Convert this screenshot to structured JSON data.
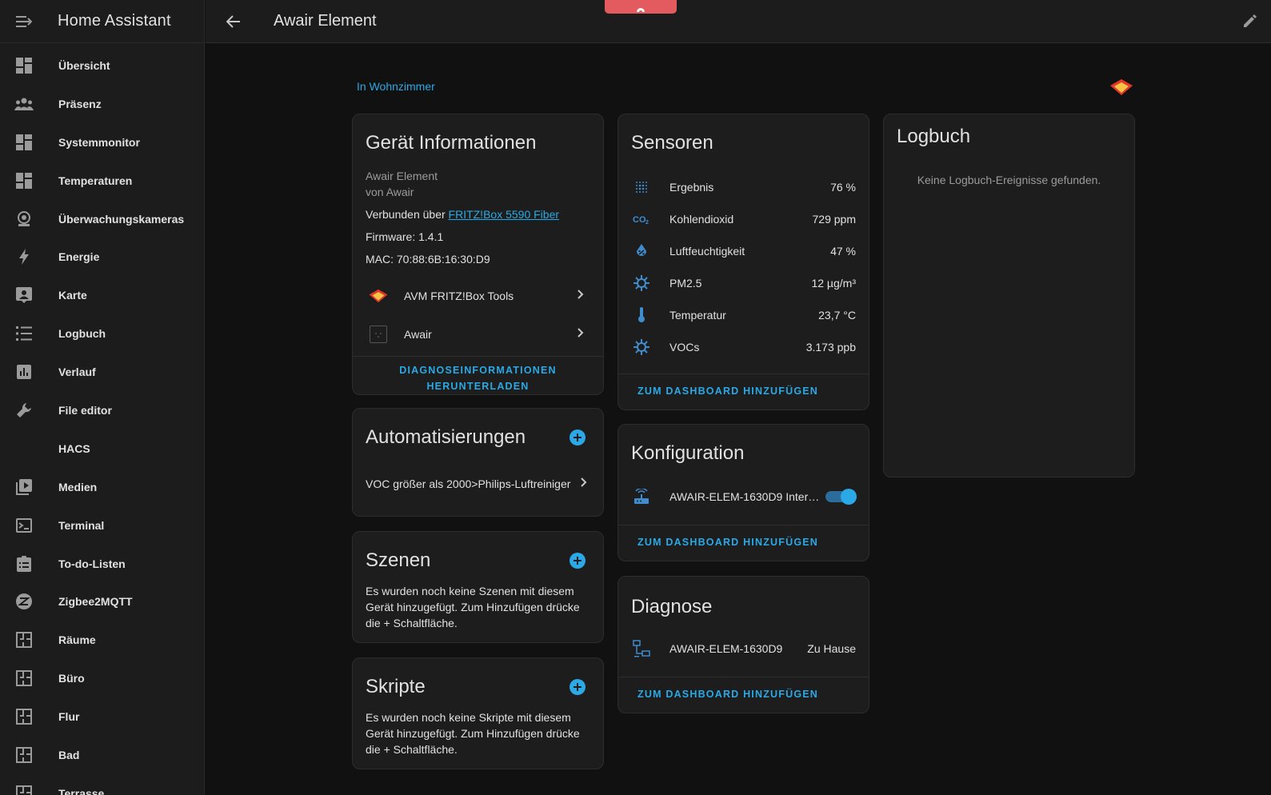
{
  "app": {
    "title": "Home Assistant"
  },
  "page": {
    "title": "Awair Element",
    "area": "In Wohnzimmer"
  },
  "colors": {
    "accent": "#2aa9e6",
    "alert": "#e35b5f",
    "sidebar_bg": "#1c1c1c",
    "card_bg": "#1d1d1d"
  },
  "sidebar": {
    "items": [
      {
        "label": "Übersicht",
        "icon": "dashboard-icon"
      },
      {
        "label": "Präsenz",
        "icon": "people-icon"
      },
      {
        "label": "Systemmonitor",
        "icon": "dashboard-icon"
      },
      {
        "label": "Temperaturen",
        "icon": "dashboard-icon"
      },
      {
        "label": "Überwachungskameras",
        "icon": "webcam-icon"
      },
      {
        "label": "Energie",
        "icon": "lightning-icon"
      },
      {
        "label": "Karte",
        "icon": "account-box-icon"
      },
      {
        "label": "Logbuch",
        "icon": "list-icon"
      },
      {
        "label": "Verlauf",
        "icon": "chart-box-icon"
      },
      {
        "label": "File editor",
        "icon": "wrench-icon"
      },
      {
        "label": "HACS",
        "icon": ""
      },
      {
        "label": "Medien",
        "icon": "play-box-icon"
      },
      {
        "label": "Terminal",
        "icon": "console-icon"
      },
      {
        "label": "To-do-Listen",
        "icon": "clipboard-list-icon"
      },
      {
        "label": "Zigbee2MQTT",
        "icon": "zigbee-icon"
      },
      {
        "label": "Räume",
        "icon": "floor-plan-icon"
      },
      {
        "label": "Büro",
        "icon": "floor-plan-icon"
      },
      {
        "label": "Flur",
        "icon": "floor-plan-icon"
      },
      {
        "label": "Bad",
        "icon": "floor-plan-icon"
      },
      {
        "label": "Terrasse",
        "icon": "floor-plan-icon"
      }
    ]
  },
  "device_info": {
    "title": "Gerät Informationen",
    "model": "Awair Element",
    "manufacturer": "von Awair",
    "connected_prefix": "Verbunden über ",
    "connected_link": "FRITZ!Box 5590 Fiber",
    "firmware": "Firmware: 1.4.1",
    "mac": "MAC: 70:88:6B:16:30:D9",
    "integrations": [
      {
        "label": "AVM FRITZ!Box Tools",
        "icon": "fritz-logo-icon"
      },
      {
        "label": "Awair",
        "icon": "awair-logo-icon"
      }
    ],
    "download_line1": "DIAGNOSEINFORMATIONEN",
    "download_line2": "HERUNTERLADEN"
  },
  "automations": {
    "title": "Automatisierungen",
    "item": "VOC größer als 2000>Philips-Luftreiniger"
  },
  "scenes": {
    "title": "Szenen",
    "text": "Es wurden noch keine Szenen mit diesem Gerät hinzugefügt. Zum Hinzufügen drücke die + Schaltfläche."
  },
  "scripts": {
    "title": "Skripte",
    "text": "Es wurden noch keine Skripte mit diesem Gerät hinzugefügt. Zum Hinzufügen drücke die + Schaltfläche."
  },
  "sensors": {
    "title": "Sensoren",
    "rows": [
      {
        "label": "Ergebnis",
        "value": "76 %",
        "icon": "blur-icon"
      },
      {
        "label": "Kohlendioxid",
        "value": "729 ppm",
        "icon": "molecule-co2-icon"
      },
      {
        "label": "Luftfeuchtigkeit",
        "value": "47 %",
        "icon": "water-percent-icon"
      },
      {
        "label": "PM2.5",
        "value": "12 µg/m³",
        "icon": "virus-icon"
      },
      {
        "label": "Temperatur",
        "value": "23,7 °C",
        "icon": "thermometer-icon"
      },
      {
        "label": "VOCs",
        "value": "3.173 ppb",
        "icon": "virus-icon"
      }
    ],
    "add_to_dashboard": "ZUM DASHBOARD HINZUFÜGEN"
  },
  "configuration": {
    "title": "Konfiguration",
    "row": {
      "label": "AWAIR-ELEM-1630D9 Inter…",
      "icon": "router-wireless-icon",
      "state": "on"
    },
    "add_to_dashboard": "ZUM DASHBOARD HINZUFÜGEN"
  },
  "diagnose": {
    "title": "Diagnose",
    "row": {
      "label": "AWAIR-ELEM-1630D9",
      "value": "Zu Hause",
      "icon": "lan-connect-icon"
    },
    "add_to_dashboard": "ZUM DASHBOARD HINZUFÜGEN"
  },
  "logbook": {
    "title": "Logbuch",
    "empty": "Keine Logbuch-Ereignisse gefunden."
  }
}
